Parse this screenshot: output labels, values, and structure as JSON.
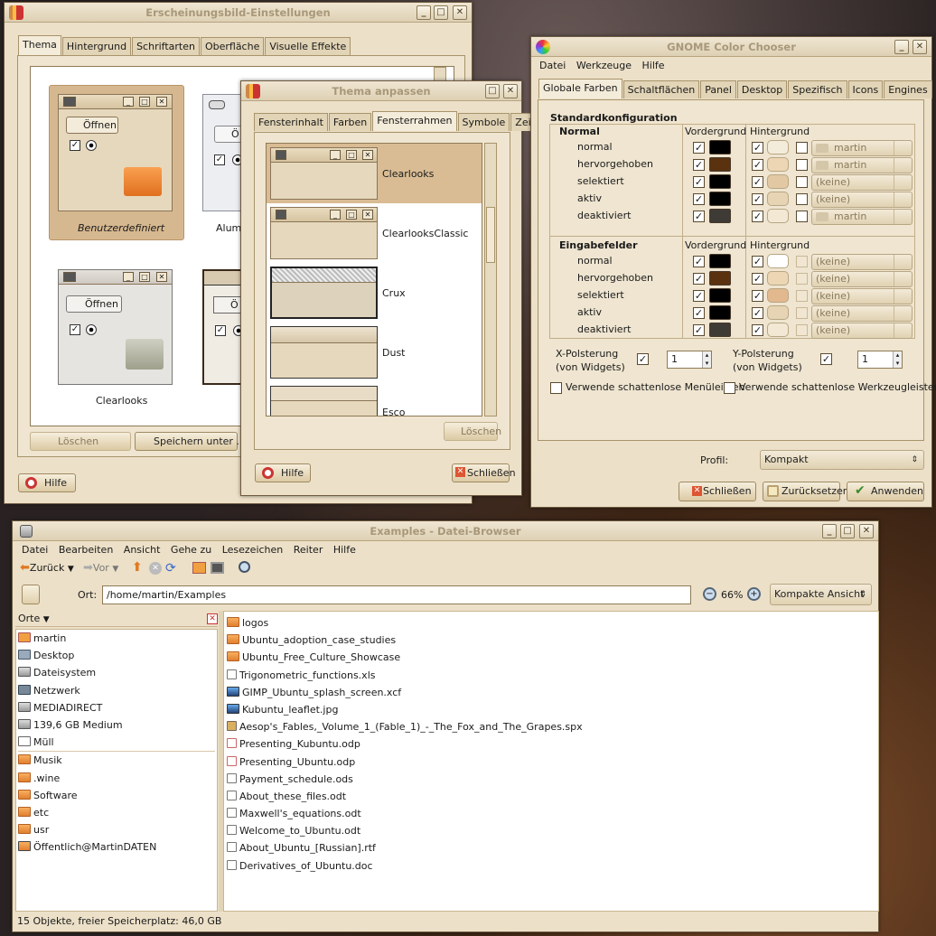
{
  "appearance": {
    "title": "Erscheinungsbild-Einstellungen",
    "tabs": [
      "Thema",
      "Hintergrund",
      "Schriftarten",
      "Oberfläche",
      "Visuelle Effekte"
    ],
    "themes": [
      "Benutzerdefiniert",
      "Alumin",
      "Clearlooks"
    ],
    "open_label": "Öffnen",
    "open_label_cut": "Ö",
    "delete_label": "Löschen",
    "save_as_label": "Speichern unter ...",
    "help_label": "Hilfe"
  },
  "customize": {
    "title": "Thema anpassen",
    "tabs": [
      "Fensterinhalt",
      "Farben",
      "Fensterrahmen",
      "Symbole",
      "Zeiger"
    ],
    "frames": [
      "Clearlooks",
      "ClearlooksClassic",
      "Crux",
      "Dust",
      "Esco"
    ],
    "delete_label": "Löschen",
    "help_label": "Hilfe",
    "close_label": "Schließen"
  },
  "colorchooser": {
    "title": "GNOME Color Chooser",
    "menu": [
      "Datei",
      "Werkzeuge",
      "Hilfe"
    ],
    "tabs": [
      "Globale Farben",
      "Schaltflächen",
      "Panel",
      "Desktop",
      "Spezifisch",
      "Icons",
      "Engines"
    ],
    "section_title": "Standardkonfiguration",
    "col_fg": "Vordergrund",
    "col_bg": "Hintergrund",
    "normal_group": "Normal",
    "input_group": "Eingabefelder",
    "normal_rows": [
      {
        "label": "normal",
        "fg": "#000000",
        "bg": "#f4ecda",
        "combo": "martin",
        "icon": true
      },
      {
        "label": "hervorgehoben",
        "fg": "#5a3210",
        "bg": "#ecd6b4",
        "combo": "martin",
        "icon": true
      },
      {
        "label": "selektiert",
        "fg": "#000000",
        "bg": "#e2c9a4",
        "combo": "(keine)",
        "icon": false
      },
      {
        "label": "aktiv",
        "fg": "#000000",
        "bg": "#e6d4b4",
        "combo": "(keine)",
        "icon": false
      },
      {
        "label": "deaktiviert",
        "fg": "#3e3a36",
        "bg": "#f2e8d4",
        "combo": "martin",
        "icon": true
      }
    ],
    "input_rows": [
      {
        "label": "normal",
        "fg": "#000000",
        "bg": "#ffffff",
        "combo": "(keine)"
      },
      {
        "label": "hervorgehoben",
        "fg": "#5a3210",
        "bg": "#ecd6b4",
        "combo": "(keine)"
      },
      {
        "label": "selektiert",
        "fg": "#000000",
        "bg": "#e2b88e",
        "combo": "(keine)"
      },
      {
        "label": "aktiv",
        "fg": "#000000",
        "bg": "#e6d4b4",
        "combo": "(keine)"
      },
      {
        "label": "deaktiviert",
        "fg": "#3e3a36",
        "bg": "#f2e8d4",
        "combo": "(keine)"
      }
    ],
    "xpad_label": "X-Polsterung",
    "ypad_label": "Y-Polsterung",
    "pad_sub": "(von Widgets)",
    "xpad_value": "1",
    "ypad_value": "1",
    "shadowless_menus": "Verwende schattenlose Menüleisten",
    "shadowless_toolbars": "Verwende schattenlose Werkzeugleisten",
    "profile_label": "Profil:",
    "profile_value": "Kompakt",
    "close_label": "Schließen",
    "reset_label": "Zurücksetzen",
    "apply_label": "Anwenden"
  },
  "browser": {
    "title": "Examples - Datei-Browser",
    "menu": [
      "Datei",
      "Bearbeiten",
      "Ansicht",
      "Gehe zu",
      "Lesezeichen",
      "Reiter",
      "Hilfe"
    ],
    "back_label": "Zurück",
    "forward_label": "Vor",
    "location_label": "Ort:",
    "location_value": "/home/martin/Examples",
    "zoom": "66%",
    "view_mode": "Kompakte Ansicht",
    "places_label": "Orte",
    "places": [
      {
        "name": "martin",
        "icon": "home-icon"
      },
      {
        "name": "Desktop",
        "icon": "desktop-icon"
      },
      {
        "name": "Dateisystem",
        "icon": "drive-icon"
      },
      {
        "name": "Netzwerk",
        "icon": "network-icon"
      },
      {
        "name": "MEDIADIRECT",
        "icon": "drive-icon"
      },
      {
        "name": "139,6 GB Medium",
        "icon": "drive-icon"
      },
      {
        "name": "Müll",
        "icon": "trash-icon"
      }
    ],
    "bookmarks": [
      {
        "name": "Musik",
        "icon": "folder-icon"
      },
      {
        "name": ".wine",
        "icon": "folder-icon"
      },
      {
        "name": "Software",
        "icon": "folder-icon"
      },
      {
        "name": "etc",
        "icon": "folder-icon"
      },
      {
        "name": "usr",
        "icon": "folder-icon"
      },
      {
        "name": "Öffentlich@MartinDATEN",
        "icon": "network-folder-icon"
      }
    ],
    "files": [
      {
        "name": "logos",
        "icon": "folder-icon"
      },
      {
        "name": "Ubuntu_adoption_case_studies",
        "icon": "folder-icon"
      },
      {
        "name": "Ubuntu_Free_Culture_Showcase",
        "icon": "folder-icon"
      },
      {
        "name": "Trigonometric_functions.xls",
        "icon": "document-icon"
      },
      {
        "name": "GIMP_Ubuntu_splash_screen.xcf",
        "icon": "image-icon"
      },
      {
        "name": "Kubuntu_leaflet.jpg",
        "icon": "image-icon"
      },
      {
        "name": "Aesop's_Fables,_Volume_1_(Fable_1)_-_The_Fox_and_The_Grapes.spx",
        "icon": "audio-icon"
      },
      {
        "name": "Presenting_Kubuntu.odp",
        "icon": "presentation-icon"
      },
      {
        "name": "Presenting_Ubuntu.odp",
        "icon": "presentation-icon"
      },
      {
        "name": "Payment_schedule.ods",
        "icon": "document-icon"
      },
      {
        "name": "About_these_files.odt",
        "icon": "document-icon"
      },
      {
        "name": "Maxwell's_equations.odt",
        "icon": "document-icon"
      },
      {
        "name": "Welcome_to_Ubuntu.odt",
        "icon": "document-icon"
      },
      {
        "name": "About_Ubuntu_[Russian].rtf",
        "icon": "document-icon"
      },
      {
        "name": "Derivatives_of_Ubuntu.doc",
        "icon": "document-icon"
      }
    ],
    "status": "15 Objekte, freier Speicherplatz: 46,0 GB"
  }
}
